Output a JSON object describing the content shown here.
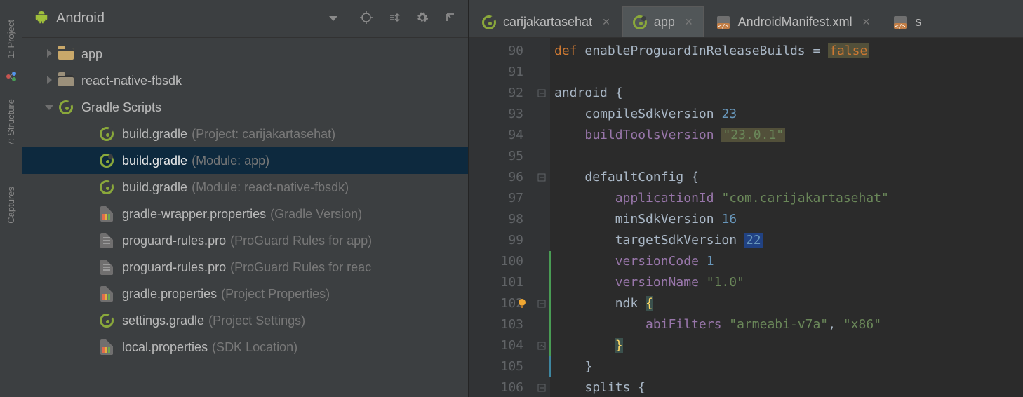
{
  "panel": {
    "title": "Android",
    "left_tabs": [
      "1: Project",
      "7: Structure",
      "Captures"
    ]
  },
  "tree": {
    "items": [
      {
        "icon": "folder",
        "label": "app",
        "hint": "",
        "level": 1,
        "arrow": "right",
        "selected": false
      },
      {
        "icon": "folder-dim",
        "label": "react-native-fbsdk",
        "hint": "",
        "level": 1,
        "arrow": "right",
        "selected": false
      },
      {
        "icon": "gradle",
        "label": "Gradle Scripts",
        "hint": "",
        "level": 1,
        "arrow": "down",
        "selected": false
      },
      {
        "icon": "gradle",
        "label": "build.gradle",
        "hint": "(Project: carijakartasehat)",
        "level": 2,
        "arrow": "",
        "selected": false
      },
      {
        "icon": "gradle",
        "label": "build.gradle",
        "hint": "(Module: app)",
        "level": 2,
        "arrow": "",
        "selected": true
      },
      {
        "icon": "gradle",
        "label": "build.gradle",
        "hint": "(Module: react-native-fbsdk)",
        "level": 2,
        "arrow": "",
        "selected": false
      },
      {
        "icon": "file-bars",
        "label": "gradle-wrapper.properties",
        "hint": "(Gradle Version)",
        "level": 2,
        "arrow": "",
        "selected": false
      },
      {
        "icon": "file-lines",
        "label": "proguard-rules.pro",
        "hint": "(ProGuard Rules for app)",
        "level": 2,
        "arrow": "",
        "selected": false
      },
      {
        "icon": "file-lines",
        "label": "proguard-rules.pro",
        "hint": "(ProGuard Rules for reac",
        "level": 2,
        "arrow": "",
        "selected": false
      },
      {
        "icon": "file-bars",
        "label": "gradle.properties",
        "hint": "(Project Properties)",
        "level": 2,
        "arrow": "",
        "selected": false
      },
      {
        "icon": "gradle",
        "label": "settings.gradle",
        "hint": "(Project Settings)",
        "level": 2,
        "arrow": "",
        "selected": false
      },
      {
        "icon": "file-bars",
        "label": "local.properties",
        "hint": "(SDK Location)",
        "level": 2,
        "arrow": "",
        "selected": false
      }
    ]
  },
  "tabs": [
    {
      "icon": "gradle",
      "label": "carijakartasehat",
      "active": false
    },
    {
      "icon": "gradle",
      "label": "app",
      "active": true
    },
    {
      "icon": "xml",
      "label": "AndroidManifest.xml",
      "active": false
    },
    {
      "icon": "xml",
      "label": "s",
      "active": false,
      "partial": true
    }
  ],
  "code": {
    "first_line": 90,
    "lines": [
      {
        "html": "<span class='kw-def'>def</span> <span class='ident'>enableProguardInReleaseBuilds</span> <span class='ident'>=</span> <span class='bool-false'>false</span>"
      },
      {
        "html": ""
      },
      {
        "html": "<span class='fn'>android</span> <span class='ident'>{</span>",
        "fold": "minus",
        "stripe": ""
      },
      {
        "html": "    <span class='fn'>compileSdkVersion</span> <span class='num'>23</span>"
      },
      {
        "html": "    <span class='field'>buildToolsVersion</span> <span class='str-hl'>\"23.0.1\"</span>"
      },
      {
        "html": ""
      },
      {
        "html": "    <span class='fn'>defaultConfig</span> <span class='ident'>{</span>",
        "fold": "minus"
      },
      {
        "html": "        <span class='field'>applicationId</span> <span class='str'>\"com.carijakartasehat\"</span>"
      },
      {
        "html": "        <span class='fn'>minSdkVersion</span> <span class='num'>16</span>"
      },
      {
        "html": "        <span class='fn'>targetSdkVersion</span> <span class='num-hl'>22</span>"
      },
      {
        "html": "        <span class='field'>versionCode</span> <span class='num'>1</span>",
        "stripe": "green"
      },
      {
        "html": "        <span class='field'>versionName</span> <span class='str'>\"1.0\"</span>",
        "stripe": "green"
      },
      {
        "html": "        <span class='fn'>ndk</span> <span class='brace-hl'>{</span>",
        "fold": "minus",
        "stripe": "green",
        "bulb": true
      },
      {
        "html": "            <span class='field'>abiFilters</span> <span class='str'>\"armeabi-v7a\"</span><span class='ident'>,</span> <span class='str'>\"x86\"</span>",
        "stripe": "green"
      },
      {
        "html": "        <span class='brace-hl'>}</span>",
        "fold": "up",
        "stripe": "green"
      },
      {
        "html": "    <span class='ident'>}</span>",
        "stripe": "blue"
      },
      {
        "html": "    <span class='fn'>splits</span> <span class='ident'>{</span>",
        "fold": "minus"
      }
    ]
  }
}
